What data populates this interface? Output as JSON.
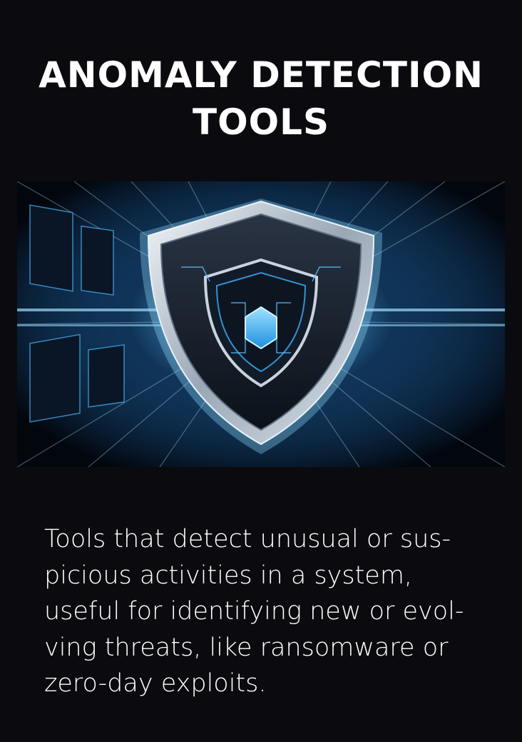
{
  "header": {
    "title_lines": [
      "ANOMALY DETECTION",
      "TOOLS"
    ]
  },
  "hero": {
    "icon": "shield-icon",
    "colors": {
      "glow": "#7fd4ff",
      "accent": "#2aa7ff",
      "dark": "#06101e"
    }
  },
  "description": {
    "lines": [
      "Tools that detect unusual or sus-",
      "picious activities in a system,",
      "useful for identifying new or evol-",
      "ving threats, like ransomware or",
      "zero-day exploits."
    ]
  },
  "colors": {
    "background": "#0b0a0f",
    "text": "#ffffff"
  }
}
